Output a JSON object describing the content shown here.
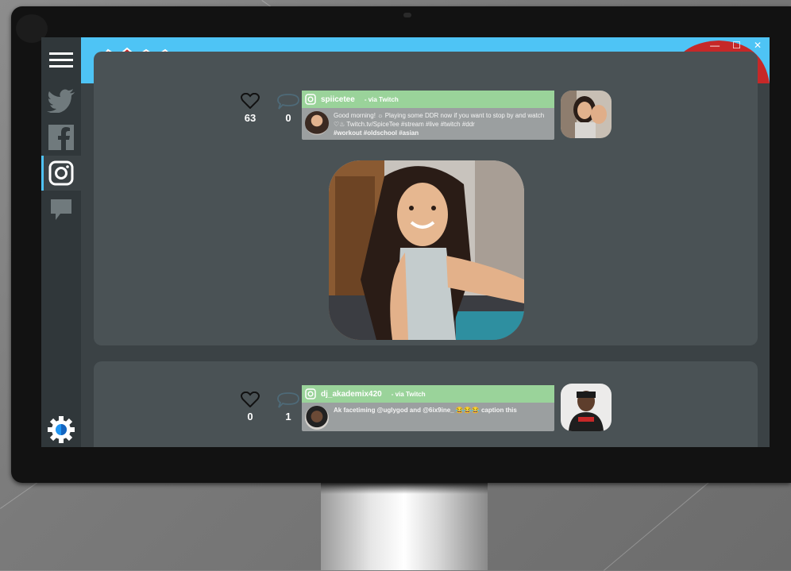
{
  "app": {
    "logo_text": "swyd",
    "accent": "#4ec4f5",
    "window_controls": [
      "—",
      "☐",
      "✕"
    ]
  },
  "sidebar": {
    "items": [
      {
        "name": "menu",
        "icon": "hamburger-icon"
      },
      {
        "name": "twitter",
        "icon": "twitter-icon"
      },
      {
        "name": "facebook",
        "icon": "facebook-icon"
      },
      {
        "name": "instagram",
        "icon": "instagram-icon",
        "active": true
      },
      {
        "name": "chat",
        "icon": "chat-icon"
      },
      {
        "name": "settings",
        "icon": "gear-icon"
      }
    ]
  },
  "posts": [
    {
      "likes": "63",
      "comments": "0",
      "username": "spiicetee",
      "via": "- via Twitch",
      "text": "Good morning! ☼ Playing some DDR now if you want to stop by and watch ♡♨   Twitch.tv/SpiceTee    #stream #live #twitch #ddr",
      "tags": "#workout #oldschool #asian"
    },
    {
      "likes": "0",
      "comments": "1",
      "username": "dj_akademix420",
      "via": "- via Twitch",
      "text": "Ak facetiming @uglygod and @6ix9ine_ 😂😂😂 caption this",
      "tags": ""
    }
  ]
}
